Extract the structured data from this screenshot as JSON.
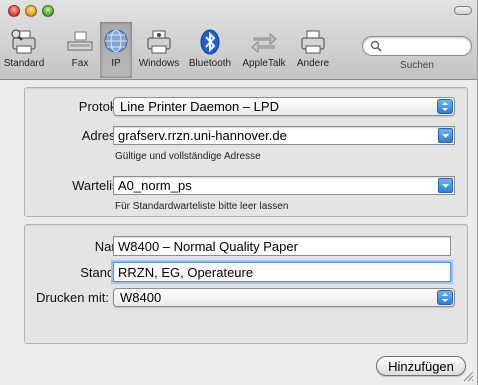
{
  "toolbar": {
    "items": [
      {
        "label": "Standard",
        "icon": "default-printer-icon"
      },
      {
        "label": "Fax",
        "icon": "fax-icon"
      },
      {
        "label": "IP",
        "icon": "ip-globe-icon",
        "selected": true
      },
      {
        "label": "Windows",
        "icon": "windows-printer-icon"
      },
      {
        "label": "Bluetooth",
        "icon": "bluetooth-icon"
      },
      {
        "label": "AppleTalk",
        "icon": "appletalk-arrows-icon"
      },
      {
        "label": "Andere",
        "icon": "other-printer-icon"
      }
    ],
    "search_value": "",
    "search_label": "Suchen"
  },
  "connection": {
    "protocol_label": "Protokoll:",
    "protocol_value": "Line Printer Daemon – LPD",
    "address_label": "Adresse:",
    "address_value": "grafserv.rrzn.uni-hannover.de",
    "address_hint": "Gültige und vollständige Adresse",
    "queue_label": "Warteliste:",
    "queue_value": "A0_norm_ps",
    "queue_hint": "Für Standardwarteliste bitte leer lassen"
  },
  "printer": {
    "name_label": "Name:",
    "name_value": "W8400 – Normal Quality Paper",
    "location_label": "Standort:",
    "location_value": "RRZN, EG, Operateure",
    "driver_label": "Drucken mit:",
    "driver_value": "W8400"
  },
  "add_button_label": "Hinzufügen",
  "colors": {
    "accent_blue": "#2c7fde",
    "focus_ring": "#9cc3f1",
    "bluetooth_blue": "#1b5fd6"
  }
}
